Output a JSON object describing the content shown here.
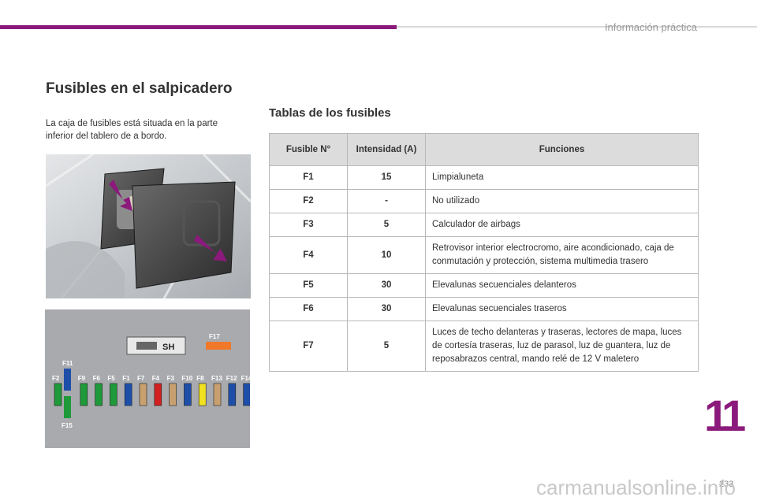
{
  "header": {
    "section": "Información práctica"
  },
  "title": "Fusibles en el salpicadero",
  "intro": "La caja de fusibles está situada en la parte inferior del tablero de a bordo.",
  "table_title": "Tablas de los fusibles",
  "table": {
    "headers": [
      "Fusible N°",
      "Intensidad (A)",
      "Funciones"
    ],
    "rows": [
      [
        "F1",
        "15",
        "Limpialuneta"
      ],
      [
        "F2",
        "-",
        "No utilizado"
      ],
      [
        "F3",
        "5",
        "Calculador de airbags"
      ],
      [
        "F4",
        "10",
        "Retrovisor interior electrocromo, aire acondicionado, caja de conmutación y protección, sistema multimedia trasero"
      ],
      [
        "F5",
        "30",
        "Elevalunas secuenciales delanteros"
      ],
      [
        "F6",
        "30",
        "Elevalunas secuenciales traseros"
      ],
      [
        "F7",
        "5",
        "Luces de techo delanteras y traseras, lectores de mapa, luces de cortesía traseras, luz de parasol, luz de guantera, luz de reposabrazos central, mando relé de 12 V maletero"
      ]
    ]
  },
  "diagram": {
    "sh_label": "SH",
    "f17": "F17",
    "f11": "F11",
    "f15": "F15",
    "fuses": [
      {
        "label": "F2",
        "color": "#1f9a3a"
      },
      {
        "label": "F9",
        "color": "#1f9a3a"
      },
      {
        "label": "F6",
        "color": "#1f9a3a"
      },
      {
        "label": "F5",
        "color": "#1f9a3a"
      },
      {
        "label": "F1",
        "color": "#1e4fa8"
      },
      {
        "label": "F7",
        "color": "#c8a070"
      },
      {
        "label": "F4",
        "color": "#d22020"
      },
      {
        "label": "F3",
        "color": "#c8a070"
      },
      {
        "label": "F10",
        "color": "#1e4fa8"
      },
      {
        "label": "F8",
        "color": "#f0e020"
      },
      {
        "label": "F13",
        "color": "#c8a070"
      },
      {
        "label": "F12",
        "color": "#1e4fa8"
      },
      {
        "label": "F14",
        "color": "#1e4fa8"
      }
    ],
    "f11_color": "#1e4fa8",
    "f15_color": "#1f9a3a",
    "f17_color": "#f07828"
  },
  "chapter": "11",
  "page": "233",
  "watermark": "carmanualsonline.info",
  "accent": "#8b1a7c"
}
